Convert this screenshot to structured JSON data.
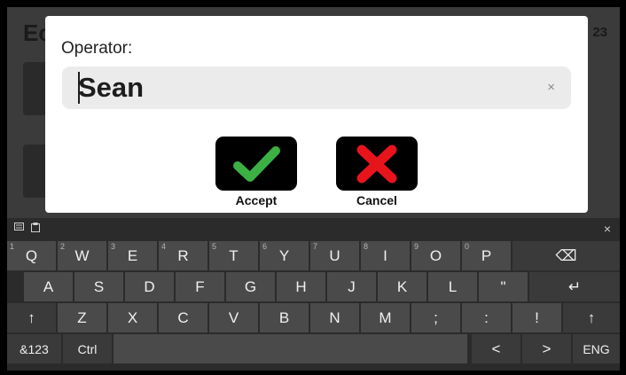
{
  "background": {
    "title": "Ec",
    "count": "23"
  },
  "dialog": {
    "operator_label": "Operator:",
    "input_value": "Sean",
    "clear_glyph": "×",
    "accept_label": "Accept",
    "cancel_label": "Cancel"
  },
  "keyboard": {
    "close_glyph": "×",
    "row1": [
      {
        "num": "1",
        "label": "Q"
      },
      {
        "num": "2",
        "label": "W"
      },
      {
        "num": "3",
        "label": "E"
      },
      {
        "num": "4",
        "label": "R"
      },
      {
        "num": "5",
        "label": "T"
      },
      {
        "num": "6",
        "label": "Y"
      },
      {
        "num": "7",
        "label": "U"
      },
      {
        "num": "8",
        "label": "I"
      },
      {
        "num": "9",
        "label": "O"
      },
      {
        "num": "0",
        "label": "P"
      }
    ],
    "backspace_glyph": "⌫",
    "row2": [
      "A",
      "S",
      "D",
      "F",
      "G",
      "H",
      "J",
      "K",
      "L",
      "\""
    ],
    "enter_glyph": "↵",
    "shift_glyph": "↑",
    "row3": [
      "Z",
      "X",
      "C",
      "V",
      "B",
      "N",
      "M",
      ";",
      ":",
      "!"
    ],
    "symbols_label": "&123",
    "ctrl_label": "Ctrl",
    "left_glyph": "<",
    "right_glyph": ">",
    "lang_label": "ENG"
  },
  "colors": {
    "accept_check": "#3cb043",
    "cancel_x": "#e8141b",
    "keyboard_bg": "#2b2b2b",
    "key_bg": "#4a4a4a"
  }
}
